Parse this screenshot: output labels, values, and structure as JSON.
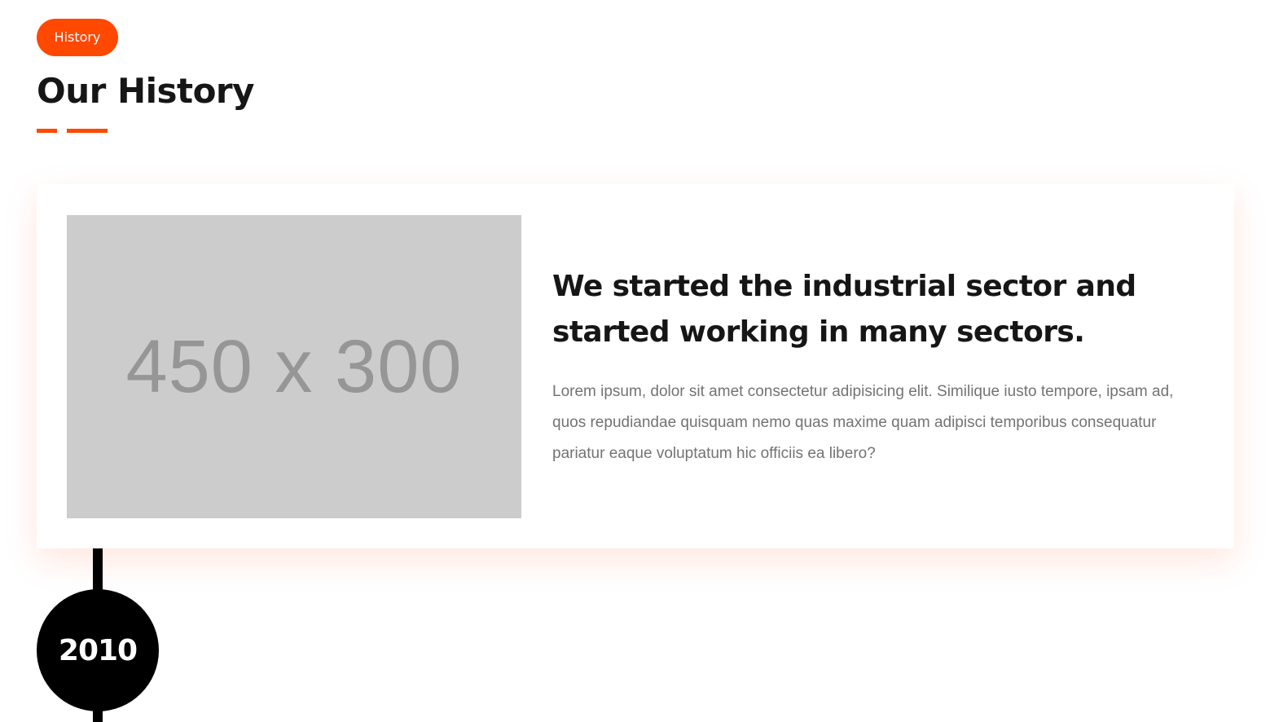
{
  "section": {
    "badge_label": "History",
    "title": "Our History"
  },
  "card": {
    "image_placeholder_text": "450 x 300",
    "heading": "We started the industrial sector and started working in many sectors.",
    "body": "Lorem ipsum, dolor sit amet consectetur adipisicing elit. Similique iusto tempore, ipsam ad, quos repudiandae quisquam nemo quas maxime quam adipisci temporibus consequatur pariatur eaque voluptatum hic officiis ea libero?"
  },
  "timeline": {
    "year": "2010"
  },
  "colors": {
    "accent": "#ff4800",
    "heading": "#161616",
    "body_text": "#737373",
    "placeholder_bg": "#cccccc",
    "timeline": "#000000"
  }
}
